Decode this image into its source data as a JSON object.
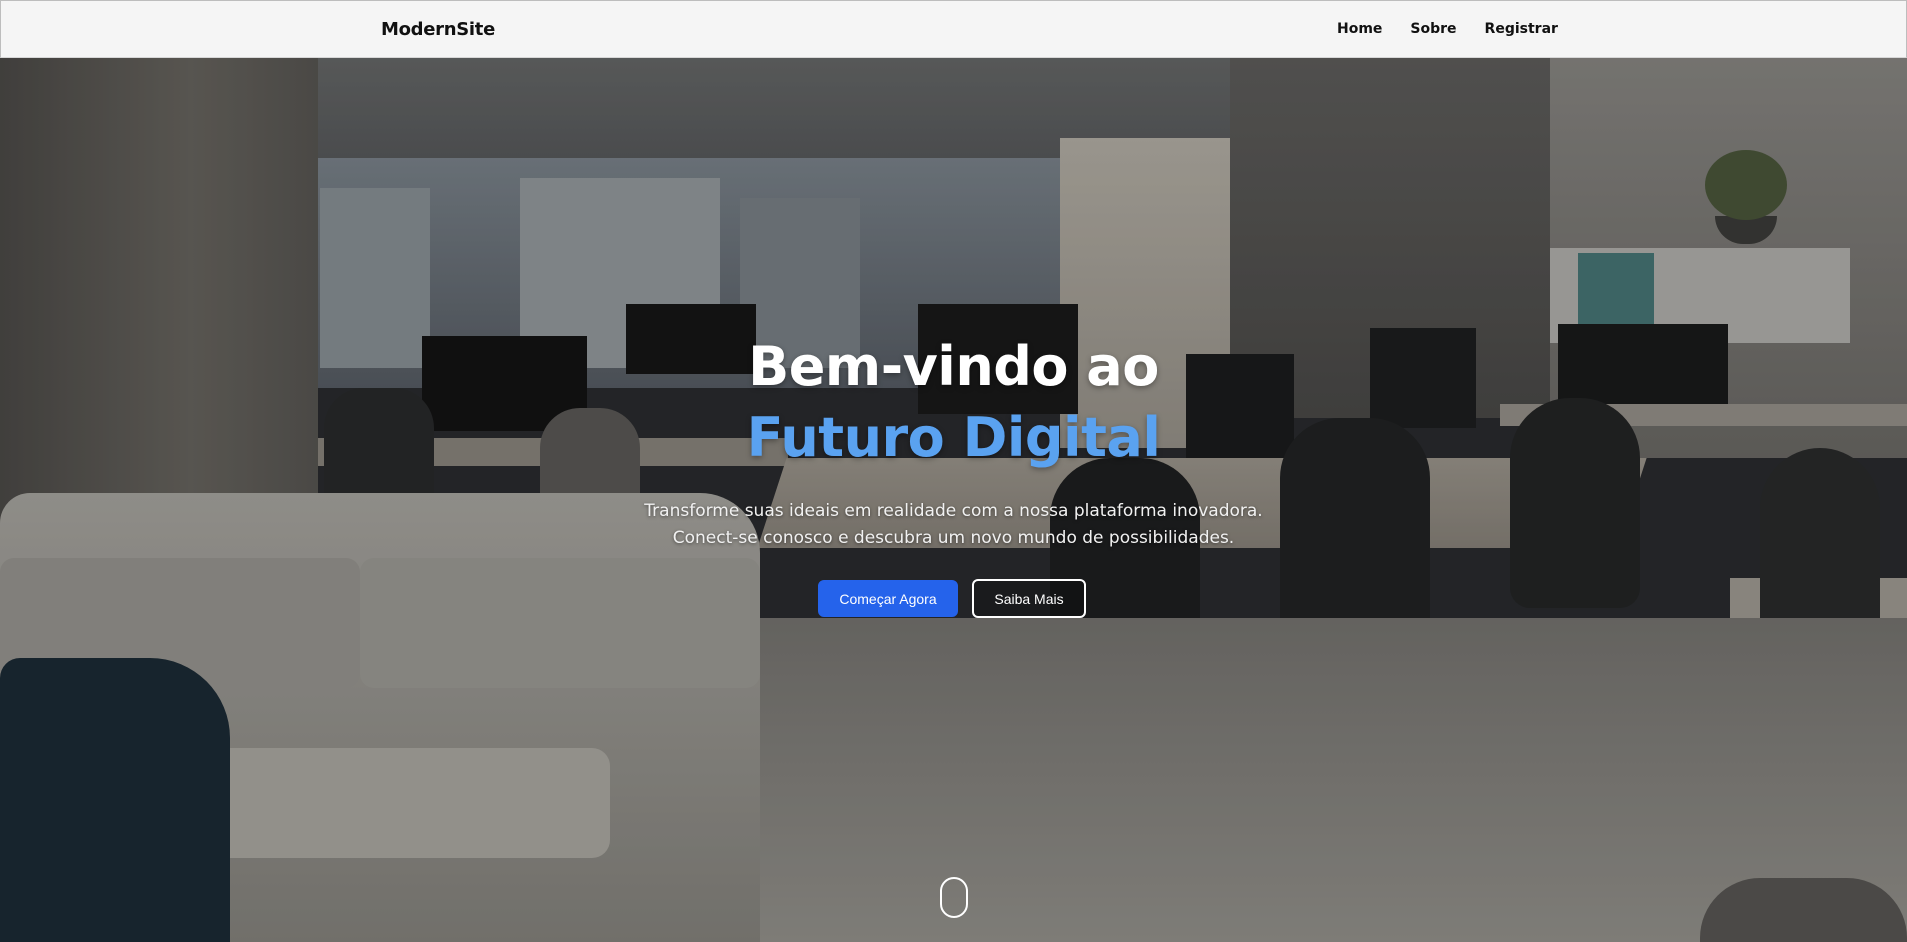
{
  "navbar": {
    "brand": "ModernSite",
    "links": [
      "Home",
      "Sobre",
      "Registrar"
    ]
  },
  "hero": {
    "headline_line1": "Bem-vindo ao",
    "headline_line2": "Futuro Digital",
    "subtitle_line1": "Transforme suas ideais em realidade com a nossa plataforma inovadora.",
    "subtitle_line2": "Conect-se conosco e descubra um novo mundo de possibilidades.",
    "primary_button": "Começar Agora",
    "secondary_button": "Saiba Mais",
    "background_image": "office-workspace-photo"
  },
  "icons": {
    "scroll_indicator": "mouse-scroll-icon"
  },
  "colors": {
    "accent": "#2563eb",
    "headline_highlight": "#5aa2f0",
    "navbar_bg": "#f5f5f5"
  }
}
